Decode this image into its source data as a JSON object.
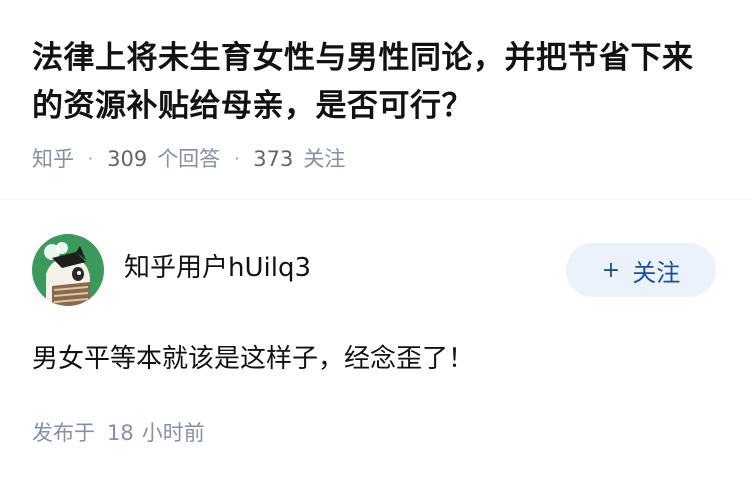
{
  "question": {
    "title": "法律上将未生育女性与男性同论，并把节省下来的资源补贴给母亲，是否可行？",
    "source": "知乎",
    "answer_count": "309",
    "answer_label": "个回答",
    "follower_count": "373",
    "follower_label": "关注"
  },
  "answer": {
    "author_name": "知乎用户hUilq3",
    "follow_button_label": "关注",
    "follow_icon": "plus-icon",
    "content": "男女平等本就该是这样子，经念歪了！",
    "time_prefix": "发布于",
    "time_value": "18",
    "time_unit": "小时前"
  },
  "colors": {
    "title": "#121212",
    "meta": "#8590a6",
    "follow_bg": "#ebf2fb",
    "follow_text": "#175199",
    "avatar_bg": "#3a9a5b"
  }
}
